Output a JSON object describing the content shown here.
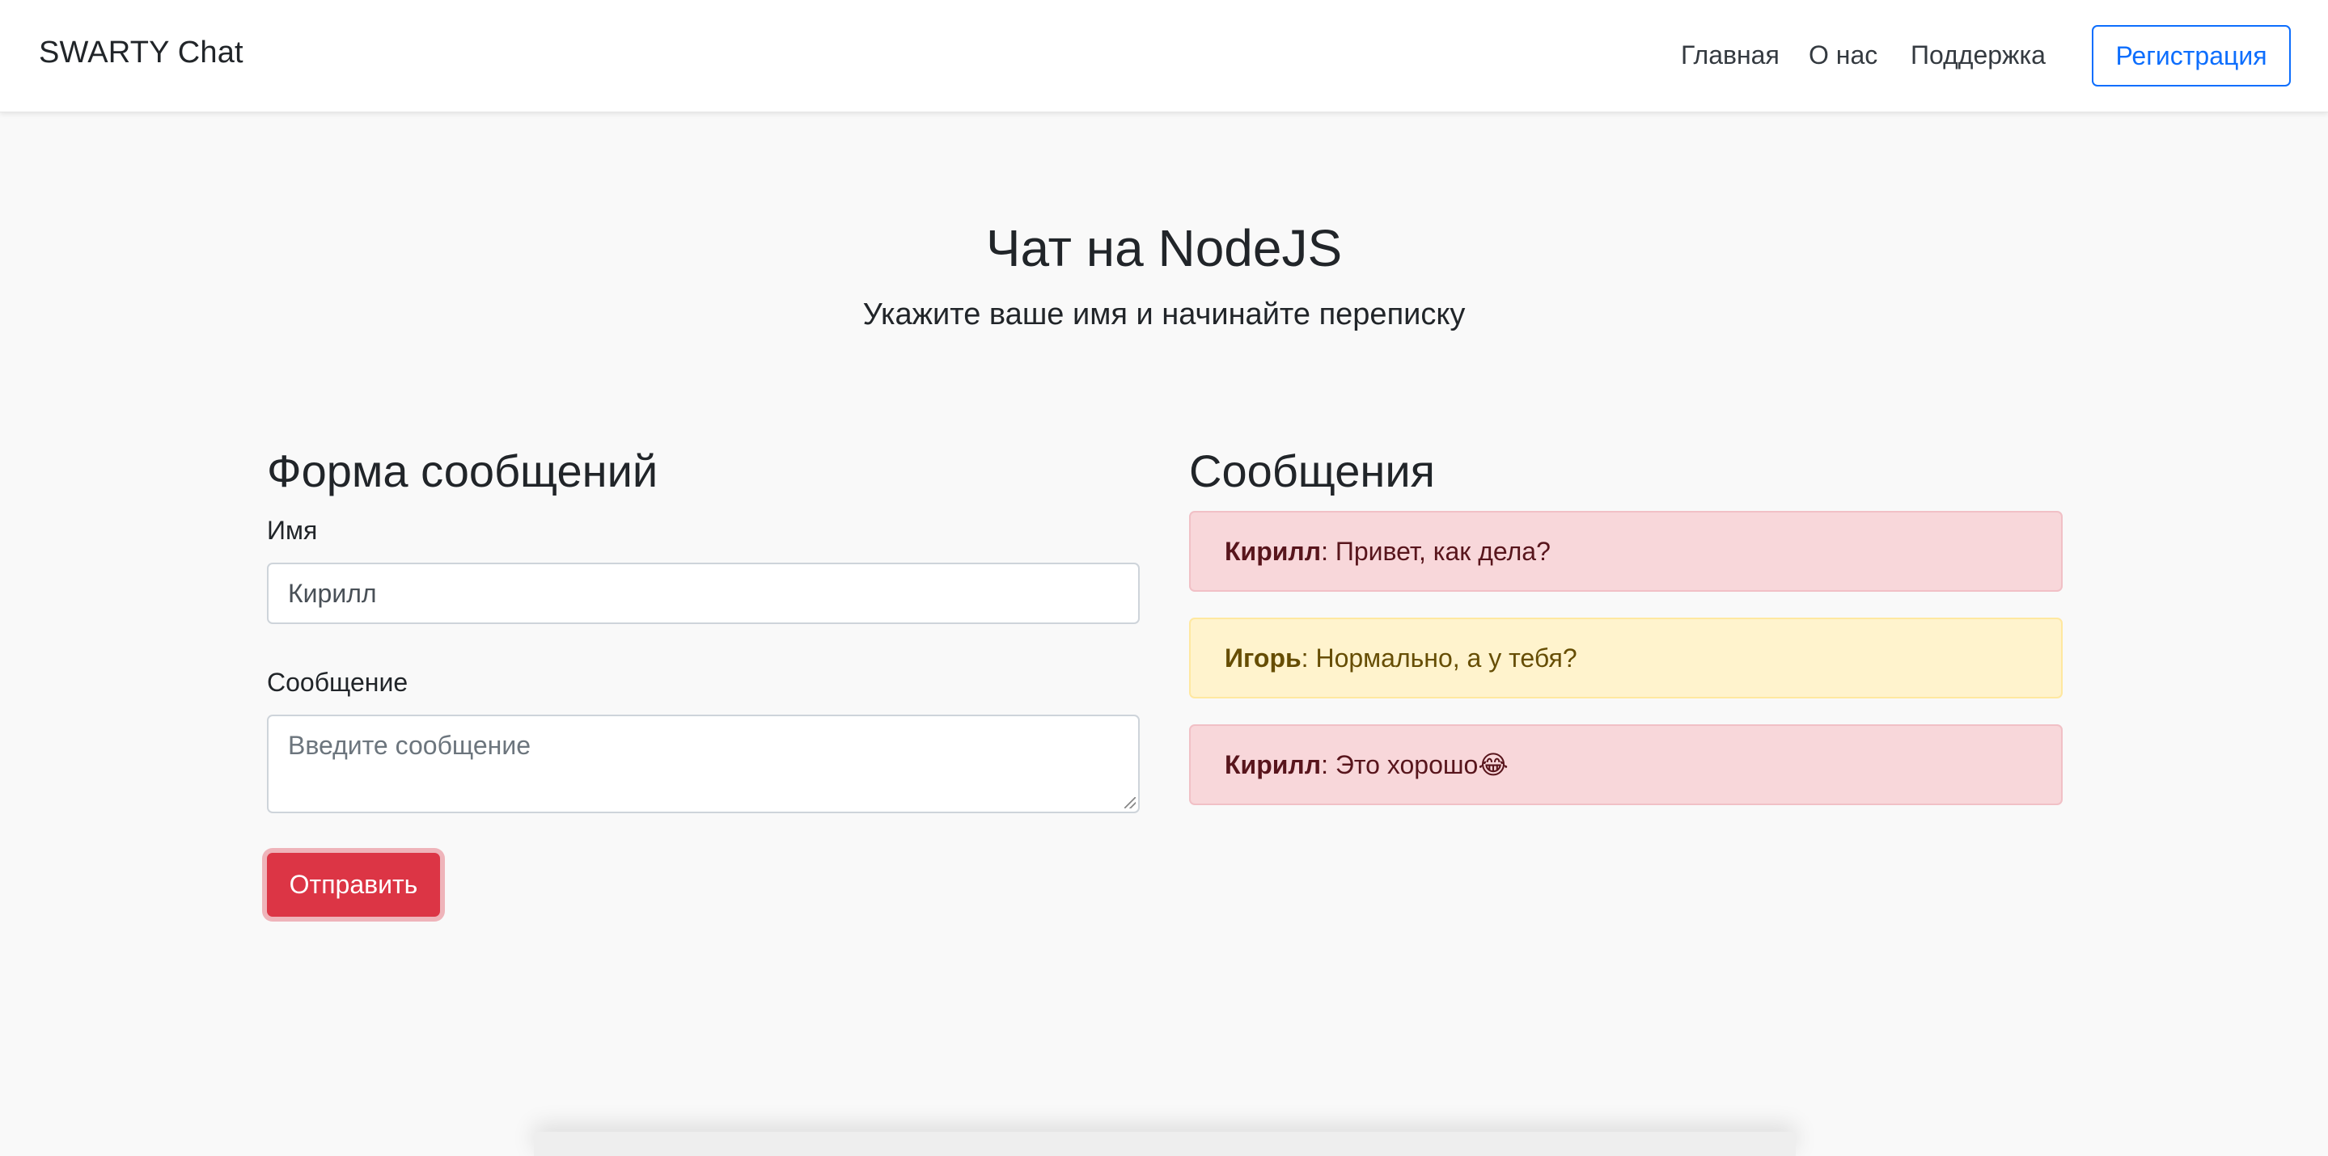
{
  "navbar": {
    "brand": "SWARTY Chat",
    "links": [
      "Главная",
      "О нас",
      "Поддержка"
    ],
    "register_label": "Регистрация"
  },
  "hero": {
    "title": "Чат на NodeJS",
    "subtitle": "Укажите ваше имя и начинайте переписку"
  },
  "form": {
    "title": "Форма сообщений",
    "name_label": "Имя",
    "name_value": "Кирилл",
    "message_label": "Сообщение",
    "message_placeholder": "Введите сообщение",
    "send_label": "Отправить"
  },
  "messages": {
    "title": "Сообщения",
    "items": [
      {
        "author": "Кирилл",
        "text": ": Привет, как дела?",
        "style": "danger"
      },
      {
        "author": "Игорь",
        "text": ": Нормально, а у тебя?",
        "style": "warning"
      },
      {
        "author": "Кирилл",
        "text": ": Это хорошо😂",
        "style": "danger"
      }
    ]
  },
  "colors": {
    "primary": "#0d6efd",
    "danger": "#dc3545",
    "danger_bg": "#f8d7da",
    "warning_bg": "#fff3cd"
  }
}
